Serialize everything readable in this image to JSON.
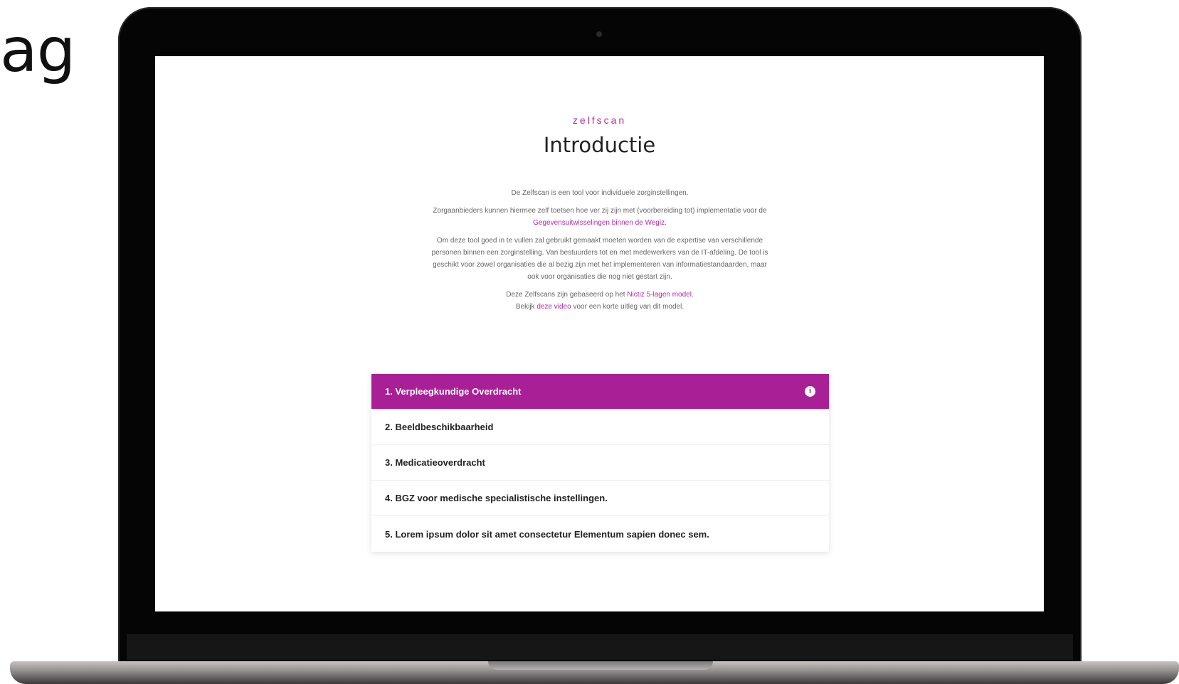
{
  "corner_text": "ag",
  "header": {
    "eyebrow": "zelfscan",
    "title": "Introductie"
  },
  "intro": {
    "p1": "De Zelfscan is een tool voor individuele zorginstellingen.",
    "p2_text": "Zorgaanbieders kunnen hiermee zelf toetsen hoe ver zij zijn met (voorbereiding tot) implementatie voor de ",
    "p2_link": "Gegevensuitwisselingen binnen de Wegiz",
    "p2_end": ".",
    "p3": "Om deze tool goed in te vullen zal gebruikt gemaakt moeten worden van de expertise van verschillende personen binnen een zorginstelling. Van bestuurders tot en met medewerkers van de IT-afdeling. De tool is geschikt voor zowel organisaties die al bezig zijn met het implementeren van informatiestandaarden, maar ook voor organisaties die nog niet gestart zijn.",
    "p4_text": "Deze Zelfscans zijn gebaseerd op het ",
    "p4_link": "Nictiz 5-lagen model",
    "p4_end": ".",
    "p5_text": "Bekijk ",
    "p5_link": "deze video",
    "p5_end": " voor een korte uitleg van dit model."
  },
  "accordion": {
    "items": [
      {
        "label": "1. Verpleegkundige Overdracht",
        "active": true
      },
      {
        "label": "2. Beeldbeschikbaarheid"
      },
      {
        "label": "3. Medicatieoverdracht"
      },
      {
        "label": "4. BGZ voor medische specialistische instellingen."
      },
      {
        "label": "5. Lorem ipsum dolor sit amet consectetur Elementum sapien donec sem."
      }
    ],
    "info_icon_glyph": "i"
  },
  "colors": {
    "accent": "#a81f96",
    "eyebrow": "#b22aa7"
  },
  "icons": [
    "info-icon",
    "camera-icon"
  ]
}
